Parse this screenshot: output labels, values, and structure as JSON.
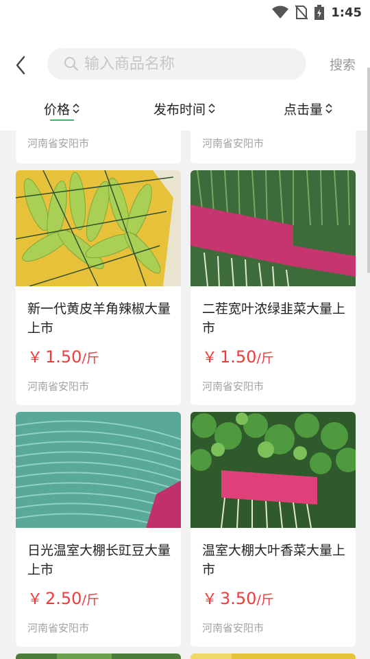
{
  "status": {
    "time": "1:45"
  },
  "search": {
    "placeholder": "输入商品名称",
    "button_label": "搜索"
  },
  "sort_tabs": [
    {
      "label": "价格"
    },
    {
      "label": "发布时间"
    },
    {
      "label": "点击量"
    }
  ],
  "partial_top": [
    {
      "location": "河南省安阳市"
    },
    {
      "location": "河南省安阳市"
    }
  ],
  "products": [
    {
      "title": "新一代黄皮羊角辣椒大量上市",
      "currency": "￥",
      "price": "1.50",
      "unit": "/斤",
      "location": "河南省安阳市"
    },
    {
      "title": "二茬宽叶浓绿韭菜大量上市",
      "currency": "￥",
      "price": "1.50",
      "unit": "/斤",
      "location": "河南省安阳市"
    },
    {
      "title": "日光温室大棚长豇豆大量上市",
      "currency": "￥",
      "price": "2.50",
      "unit": "/斤",
      "location": "河南省安阳市"
    },
    {
      "title": "温室大棚大叶香菜大量上市",
      "currency": "￥",
      "price": "3.50",
      "unit": "/斤",
      "location": "河南省安阳市"
    }
  ],
  "colors": {
    "accent": "#2fbf6f",
    "price": "#f23a3a"
  }
}
